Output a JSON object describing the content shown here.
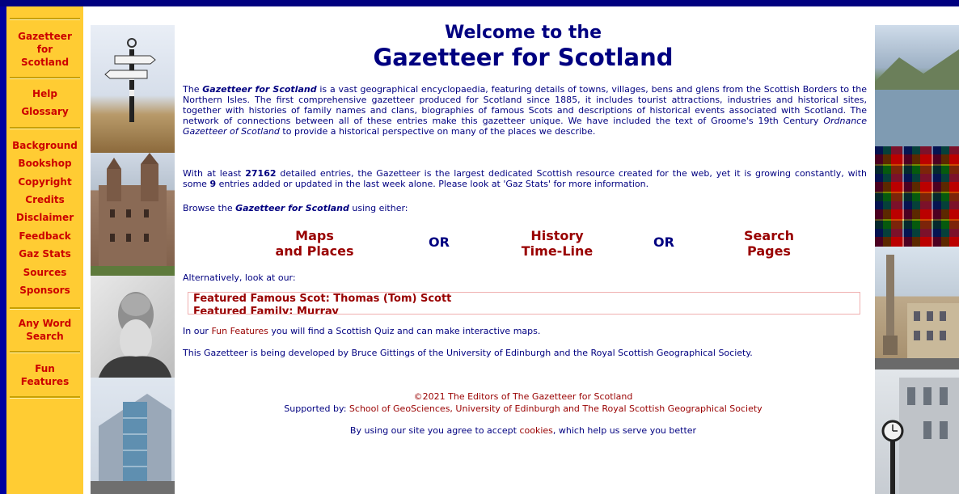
{
  "nav": {
    "items": [
      {
        "label": "Gazetteer\nfor\nScotland",
        "name": "nav-home"
      },
      {
        "label": "Help",
        "name": "nav-help"
      },
      {
        "label": "Glossary",
        "name": "nav-glossary"
      },
      {
        "label": "Background",
        "name": "nav-background"
      },
      {
        "label": "Bookshop",
        "name": "nav-bookshop"
      },
      {
        "label": "Copyright",
        "name": "nav-copyright"
      },
      {
        "label": "Credits",
        "name": "nav-credits"
      },
      {
        "label": "Disclaimer",
        "name": "nav-disclaimer"
      },
      {
        "label": "Feedback",
        "name": "nav-feedback"
      },
      {
        "label": "Gaz Stats",
        "name": "nav-gaz-stats"
      },
      {
        "label": "Sources",
        "name": "nav-sources"
      },
      {
        "label": "Sponsors",
        "name": "nav-sponsors"
      },
      {
        "label": "Any Word\nSearch",
        "name": "nav-any-word-search"
      },
      {
        "label": "Fun\nFeatures",
        "name": "nav-fun-features"
      }
    ]
  },
  "header": {
    "line1": "Welcome to the",
    "line2": "Gazetteer for Scotland"
  },
  "intro": {
    "title_em": "Gazetteer for Scotland",
    "text_before": "The ",
    "text_a": " is a vast geographical encyclopaedia, featuring details of towns, villages, bens and glens from the Scottish Borders to the Northern Isles. The first comprehensive gazetteer produced for Scotland since 1885, it includes tourist attractions, industries and historical sites, together with histories of family names and clans, biographies of famous Scots and descriptions of historical events associated with Scotland. The network of connections between all of these entries make this gazetteer unique. We have included the text of Groome's 19th Century ",
    "ordnance": "Ordnance Gazetteer of Scotland",
    "text_b": " to provide a historical perspective on many of the places we describe."
  },
  "stats": {
    "text_before": "With at least ",
    "count": "27162",
    "text_mid": " detailed entries, the Gazetteer is the largest dedicated Scottish resource created for the web, yet it is growing constantly, with some ",
    "weekly": "9",
    "text_after": " entries added or updated in the last week alone. Please look at 'Gaz Stats' for more information."
  },
  "browse": {
    "before": "Browse the ",
    "title_em": "Gazetteer for Scotland",
    "after": " using either:",
    "maps": "Maps\nand Places",
    "history": "History\nTime-Line",
    "search": "Search\nPages",
    "or": "OR"
  },
  "alternatively": "Alternatively, look at our:",
  "featured": {
    "scot": "Featured Famous Scot: Thomas (Tom) Scott",
    "family": "Featured Family: Murray"
  },
  "fun": {
    "before": "In our ",
    "link": "Fun Features",
    "after": " you will find a Scottish Quiz and can make interactive maps."
  },
  "developed": "This Gazetteer is being developed by Bruce Gittings of the University of Edinburgh and the Royal Scottish Geographical Society.",
  "footer": {
    "copyright": "©2021 The Editors of The Gazetteer for Scotland",
    "supported_label": "Supported by: ",
    "supported_link": "School of GeoSciences, University of Edinburgh and The Royal Scottish Geographical Society",
    "cookies_before": "By using our site you agree to accept ",
    "cookies_link": "cookies",
    "cookies_after": ", which help us serve you better"
  },
  "colors": {
    "navy": "#000080",
    "nav_bg": "#ffcc33",
    "link_red": "#990000"
  }
}
